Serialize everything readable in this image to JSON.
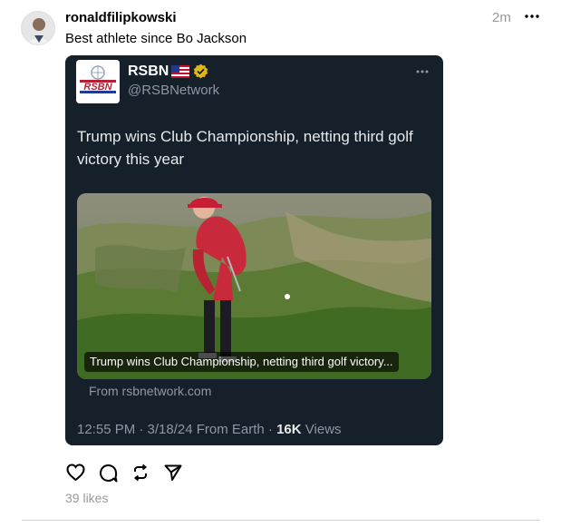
{
  "post": {
    "username": "ronaldfilipkowski",
    "timestamp": "2m",
    "caption": "Best athlete since Bo Jackson",
    "likes": "39 likes"
  },
  "embed": {
    "logo_text": "RSBN",
    "name": "RSBN",
    "flag": "🇺🇸",
    "handle": "@RSBNetwork",
    "text": "Trump wins Club Championship, netting third golf victory this year",
    "media_caption": "Trump wins Club Championship, netting third golf victory...",
    "source": "From rsbnetwork.com",
    "meta_time": "12:55 PM · 3/18/24 From Earth · ",
    "meta_views_count": "16K",
    "meta_views_label": " Views"
  },
  "icons": {
    "more": "more-horizontal-icon",
    "like": "heart-icon",
    "reply": "comment-icon",
    "repost": "repost-icon",
    "share": "send-icon"
  },
  "colors": {
    "card_bg": "#15202b",
    "verified_gold": "#e2b719",
    "muted_text": "#8b98a5"
  }
}
